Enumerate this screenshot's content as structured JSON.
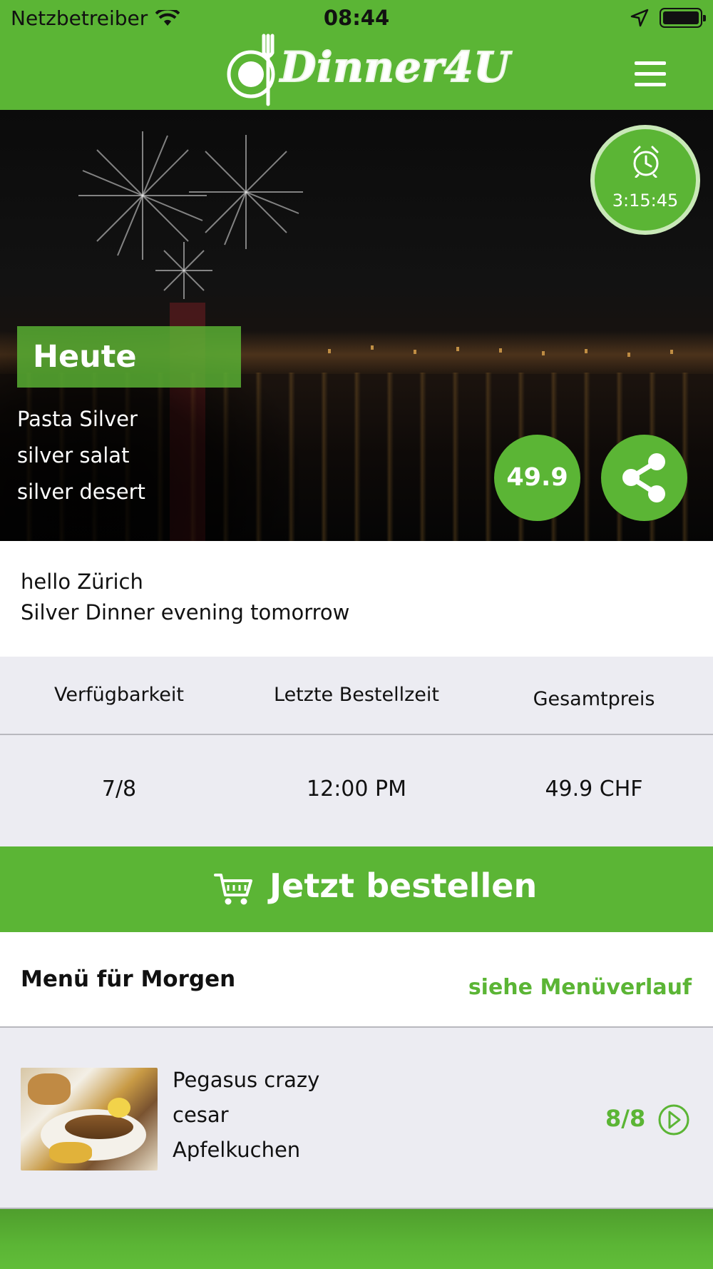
{
  "status_bar": {
    "carrier": "Netzbetreiber",
    "time": "08:44"
  },
  "header": {
    "logo_text": "Dinner4U",
    "menu_icon": "hamburger-menu-icon"
  },
  "hero": {
    "timer": "3:15:45",
    "timer_icon": "alarm-clock-icon",
    "badge": "Heute",
    "dishes": [
      "Pasta Silver",
      "silver salat",
      "silver desert"
    ],
    "price": "49.9",
    "share_icon": "share-icon"
  },
  "description": {
    "line1": "hello Zürich",
    "line2": "Silver Dinner evening tomorrow"
  },
  "info": {
    "headers": [
      "Verfügbarkeit",
      "Letzte Bestellzeit",
      "Gesamtpreis"
    ],
    "values": [
      "7/8",
      "12:00 PM",
      "49.9 CHF"
    ]
  },
  "order": {
    "label": "Jetzt bestellen",
    "icon": "shopping-cart-icon"
  },
  "tomorrow": {
    "title": "Menü für Morgen",
    "history_link": "siehe Menüverlauf",
    "items": [
      "Pegasus crazy",
      "cesar",
      "Apfelkuchen"
    ],
    "availability": "8/8",
    "arrow_icon": "chevron-right-circle-icon"
  },
  "colors": {
    "accent": "#5bb535",
    "accent_light": "#c9e8b8",
    "background": "#ececf2"
  }
}
